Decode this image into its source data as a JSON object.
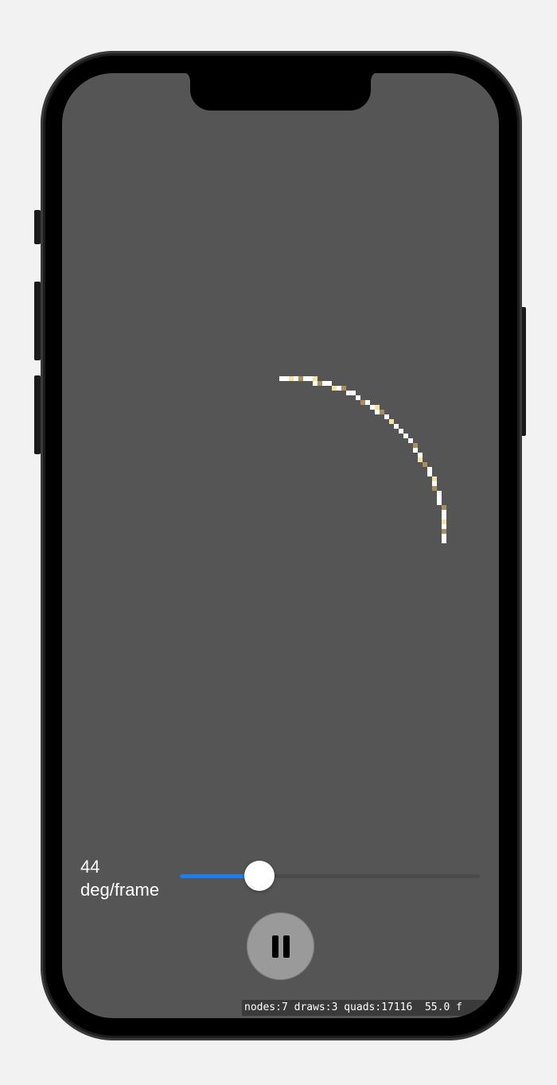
{
  "speed": {
    "value": "44",
    "unit": "deg/frame",
    "slider_fraction": 0.265
  },
  "colors": {
    "screen_background": "#555555",
    "arc_primary": "#ffffff",
    "arc_secondary": "#f3e3a6",
    "arc_shadow": "#a98f5e",
    "slider_fill": "#1a7ef2",
    "pause_button": "#9a9a9a"
  },
  "controls": {
    "pause_icon": "pause-icon"
  },
  "stats": {
    "text": "nodes:7 draws:3 quads:17116  55.0 f"
  }
}
